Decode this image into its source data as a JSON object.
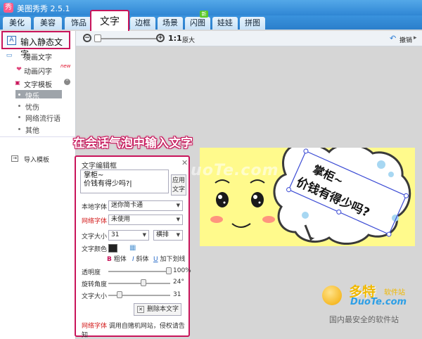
{
  "app": {
    "title": "美图秀秀 2.5.1",
    "logo": "秀"
  },
  "tabs": [
    {
      "label": "美化",
      "id": "beautify"
    },
    {
      "label": "美容",
      "id": "beauty"
    },
    {
      "label": "饰品",
      "id": "accessories"
    },
    {
      "label": "文字",
      "id": "text",
      "active": true
    },
    {
      "label": "边框",
      "id": "frame"
    },
    {
      "label": "场景",
      "id": "scene"
    },
    {
      "label": "闪图",
      "id": "flash",
      "badge": "新"
    },
    {
      "label": "娃娃",
      "id": "doll"
    },
    {
      "label": "拼图",
      "id": "collage"
    }
  ],
  "toolbar": {
    "zoom_ratio": "1:1",
    "original_label": "原大",
    "undo_label": "撤销",
    "zoom_in": "+",
    "zoom_out": "−"
  },
  "sidebar": {
    "top_item": {
      "label": "输入静态文字",
      "icon": "A"
    },
    "items": [
      {
        "label": "漫画文字",
        "icon": "comic-text-icon"
      },
      {
        "label": "动画闪字",
        "icon": "heart-icon",
        "badge": "new"
      },
      {
        "label": "文字模板",
        "icon": "template-icon"
      }
    ],
    "sub_items": [
      "快乐",
      "忧伤",
      "网络流行语",
      "其他"
    ],
    "selected_sub": "快乐",
    "import_label": "导入模板"
  },
  "caption": "在会话气泡中输入文字",
  "watermark": "www.DuoTe.com",
  "photo": {
    "bubble_text_line1": "掌柜~",
    "bubble_text_line2": "价钱有得少吗?",
    "bg_color": "#fffa8c"
  },
  "editor": {
    "title": "文字编辑框",
    "text_value": "掌柜~\n价钱有得少吗?|",
    "apply_label": "应用文字",
    "local_font_label": "本地字体",
    "local_font_value": "迷你简卡通",
    "web_font_label": "网络字体",
    "web_font_value": "未使用",
    "font_size_label": "文字大小",
    "font_size_value": "31",
    "orientation_value": "横排",
    "color_label": "文字颜色",
    "bold_label": "粗体",
    "italic_label": "斜体",
    "underline_label": "加下划线",
    "opacity_label": "透明度",
    "opacity_value": "100%",
    "opacity_level": 1.0,
    "rotation_label": "旋转角度",
    "rotation_value": "24°",
    "rotation_level": 0.63,
    "size_label": "文字大小",
    "size_value": "31",
    "size_level": 0.12,
    "delete_label": "删除本文字",
    "footer_red": "网络字体",
    "footer_text": "调用自赌机网站，侵权请告知"
  },
  "brand": {
    "cn": "多特",
    "cn_small": "软件站",
    "en": "DuoTe.com",
    "slogan": "国内最安全的软件站"
  }
}
